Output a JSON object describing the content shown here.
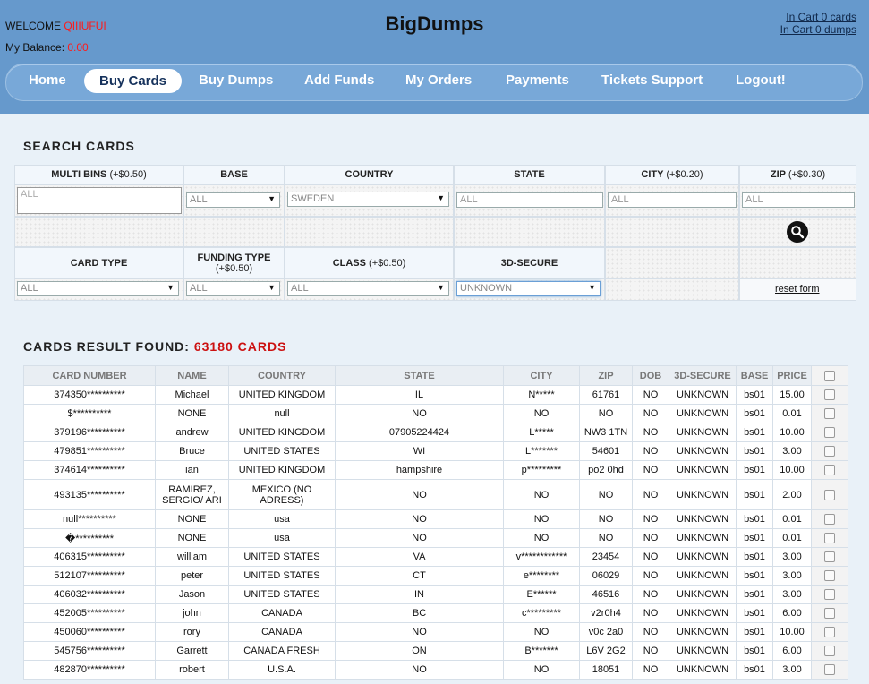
{
  "header": {
    "welcome_label": "WELCOME",
    "username": "QIIIUFUI",
    "balance_label": "My Balance:",
    "balance_value": "0.00",
    "site_title": "BigDumps",
    "cart_cards": "In Cart 0 cards",
    "cart_dumps": "In Cart 0 dumps"
  },
  "nav": {
    "items": [
      "Home",
      "Buy Cards",
      "Buy Dumps",
      "Add Funds",
      "My Orders",
      "Payments",
      "Tickets Support",
      "Logout!"
    ],
    "active": "Buy Cards"
  },
  "search": {
    "title": "SEARCH CARDS",
    "headers": {
      "multi_bins": "MULTI BINS",
      "multi_bins_extra": "(+$0.50)",
      "base": "BASE",
      "country": "COUNTRY",
      "state": "STATE",
      "city": "CITY",
      "city_extra": "(+$0.20)",
      "zip": "ZIP",
      "zip_extra": "(+$0.30)",
      "card_type": "CARD TYPE",
      "funding_type": "FUNDING TYPE",
      "funding_extra": "(+$0.50)",
      "class": "CLASS",
      "class_extra": "(+$0.50)",
      "secure": "3D-SECURE"
    },
    "fields": {
      "bins_placeholder": "ALL",
      "base_value": "ALL",
      "country_value": "SWEDEN",
      "state_placeholder": "ALL",
      "city_placeholder": "ALL",
      "zip_placeholder": "ALL",
      "card_type_value": "ALL",
      "funding_value": "ALL",
      "class_value": "ALL",
      "secure_value": "UNKNOWN"
    },
    "reset_label": "reset form"
  },
  "results": {
    "title": "CARDS RESULT FOUND:",
    "count": "63180 CARDS",
    "columns": [
      "CARD NUMBER",
      "NAME",
      "COUNTRY",
      "STATE",
      "CITY",
      "ZIP",
      "DOB",
      "3D-SECURE",
      "BASE",
      "PRICE"
    ],
    "rows": [
      [
        "374350**********",
        "Michael",
        "UNITED KINGDOM",
        "IL",
        "N*****",
        "61761",
        "NO",
        "UNKNOWN",
        "bs01",
        "15.00"
      ],
      [
        "$**********",
        "NONE",
        "null",
        "NO",
        "NO",
        "NO",
        "NO",
        "UNKNOWN",
        "bs01",
        "0.01"
      ],
      [
        "379196**********",
        "andrew",
        "UNITED KINGDOM",
        "07905224424",
        "L*****",
        "NW3 1TN",
        "NO",
        "UNKNOWN",
        "bs01",
        "10.00"
      ],
      [
        "479851**********",
        "Bruce",
        "UNITED STATES",
        "WI",
        "L*******",
        "54601",
        "NO",
        "UNKNOWN",
        "bs01",
        "3.00"
      ],
      [
        "374614**********",
        "ian",
        "UNITED KINGDOM",
        "hampshire",
        "p*********",
        "po2 0hd",
        "NO",
        "UNKNOWN",
        "bs01",
        "10.00"
      ],
      [
        "493135**********",
        "RAMIREZ, SERGIO/ ARI",
        "MEXICO (NO ADRESS)",
        "NO",
        "NO",
        "NO",
        "NO",
        "UNKNOWN",
        "bs01",
        "2.00"
      ],
      [
        "null**********",
        "NONE",
        "usa",
        "NO",
        "NO",
        "NO",
        "NO",
        "UNKNOWN",
        "bs01",
        "0.01"
      ],
      [
        "�**********",
        "NONE",
        "usa",
        "NO",
        "NO",
        "NO",
        "NO",
        "UNKNOWN",
        "bs01",
        "0.01"
      ],
      [
        "406315**********",
        "william",
        "UNITED STATES",
        "VA",
        "v************",
        "23454",
        "NO",
        "UNKNOWN",
        "bs01",
        "3.00"
      ],
      [
        "512107**********",
        "peter",
        "UNITED STATES",
        "CT",
        "e********",
        "06029",
        "NO",
        "UNKNOWN",
        "bs01",
        "3.00"
      ],
      [
        "406032**********",
        "Jason",
        "UNITED STATES",
        "IN",
        "E******",
        "46516",
        "NO",
        "UNKNOWN",
        "bs01",
        "3.00"
      ],
      [
        "452005**********",
        "john",
        "CANADA",
        "BC",
        "c*********",
        "v2r0h4",
        "NO",
        "UNKNOWN",
        "bs01",
        "6.00"
      ],
      [
        "450060**********",
        "rory",
        "CANADA",
        "NO",
        "NO",
        "v0c 2a0",
        "NO",
        "UNKNOWN",
        "bs01",
        "10.00"
      ],
      [
        "545756**********",
        "Garrett",
        "CANADA FRESH",
        "ON",
        "B*******",
        "L6V 2G2",
        "NO",
        "UNKNOWN",
        "bs01",
        "6.00"
      ],
      [
        "482870**********",
        "robert",
        "U.S.A.",
        "NO",
        "NO",
        "18051",
        "NO",
        "UNKNOWN",
        "bs01",
        "3.00"
      ]
    ]
  }
}
